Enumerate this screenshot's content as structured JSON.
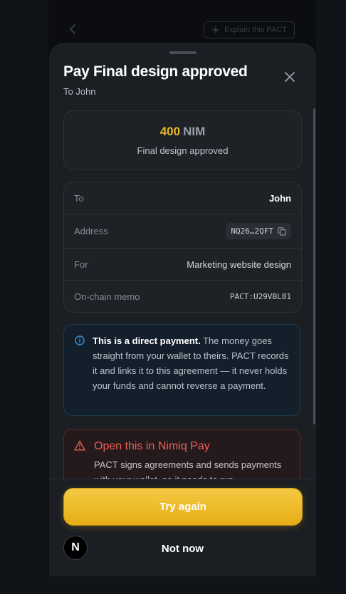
{
  "background": {
    "explain_label": "Explain this PACT"
  },
  "sheet": {
    "title": "Pay Final design approved",
    "subtitle": "To John"
  },
  "amount": {
    "value": "400",
    "unit": "NIM",
    "description": "Final design approved"
  },
  "details": {
    "rows": [
      {
        "label": "To",
        "value": "John"
      },
      {
        "label": "Address",
        "value": "NQ26…2QFT"
      },
      {
        "label": "For",
        "value": "Marketing website design"
      },
      {
        "label": "On-chain memo",
        "value": "PACT:U29VBL81"
      }
    ]
  },
  "info": {
    "bold": "This is a direct payment.",
    "text": " The money goes straight from your wallet to theirs. PACT records it and links it to this agreement — it never holds your funds and cannot reverse a payment."
  },
  "warning": {
    "title": "Open this in Nimiq Pay",
    "text": "PACT signs agreements and sends payments with your wallet, so it needs to run"
  },
  "footer": {
    "primary_label": "Try again",
    "secondary_label": "Not now"
  },
  "badge": {
    "letter": "N"
  },
  "colors": {
    "accent_gold": "#e8b627",
    "danger": "#f05c55",
    "info_blue": "#3d8fd6"
  }
}
